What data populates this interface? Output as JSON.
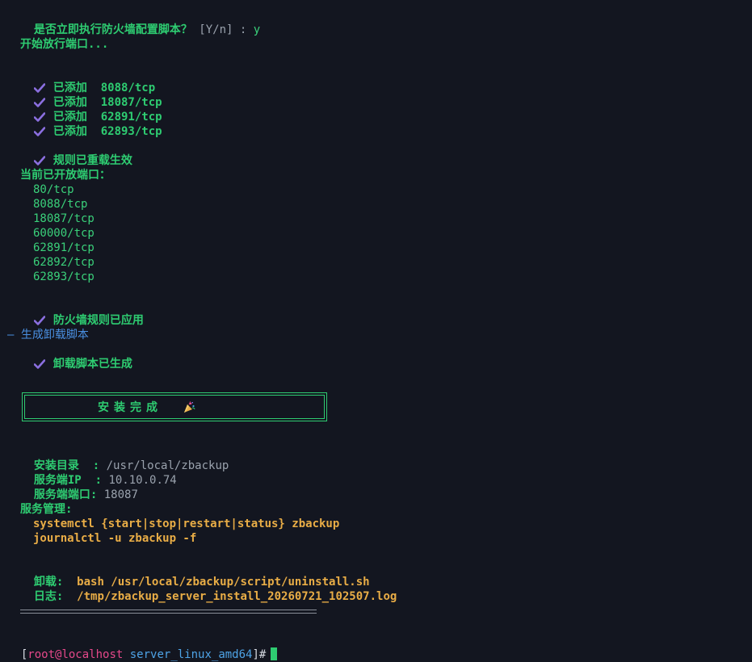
{
  "confirm": {
    "question": "是否立即执行防火墙配置脚本？",
    "options": "[Y/n] :",
    "answer": "y"
  },
  "opening_ports": "开始放行端口...",
  "added": [
    {
      "label": "已添加",
      "port": "8088/tcp"
    },
    {
      "label": "已添加",
      "port": "18087/tcp"
    },
    {
      "label": "已添加",
      "port": "62891/tcp"
    },
    {
      "label": "已添加",
      "port": "62893/tcp"
    }
  ],
  "reloaded": "规则已重载生效",
  "open_ports_title": "当前已开放端口：",
  "open_ports": [
    "80/tcp",
    "8088/tcp",
    "18087/tcp",
    "60000/tcp",
    "62891/tcp",
    "62892/tcp",
    "62893/tcp"
  ],
  "firewall_applied": "防火墙规则已应用",
  "section_uninstall": "— 生成卸载脚本",
  "uninstall_generated": "卸载脚本已生成",
  "install_done": "安装完成",
  "install_dir": {
    "label": "安装目录  :",
    "value": "/usr/local/zbackup"
  },
  "server_ip": {
    "label": "服务端IP  :",
    "value": "10.10.0.74"
  },
  "server_port": {
    "label": "服务端端口:",
    "value": "18087"
  },
  "service_mgmt": {
    "title": "服务管理:",
    "cmd1": "systemctl {start|stop|restart|status} zbackup",
    "cmd2": "journalctl -u zbackup -f"
  },
  "uninstall": {
    "label": "卸载:",
    "value": "bash /usr/local/zbackup/script/uninstall.sh"
  },
  "log": {
    "label": "日志:",
    "value": "/tmp/zbackup_server_install_20260721_102507.log"
  },
  "prompt": {
    "user_host": "root@localhost",
    "dir": "server_linux_amd64"
  },
  "colors": {
    "background": "#131620",
    "green": "#2ecc71",
    "check": "#8b6fe0",
    "orange": "#e9ad46",
    "blue": "#4a90e2",
    "user": "#e5488a"
  }
}
